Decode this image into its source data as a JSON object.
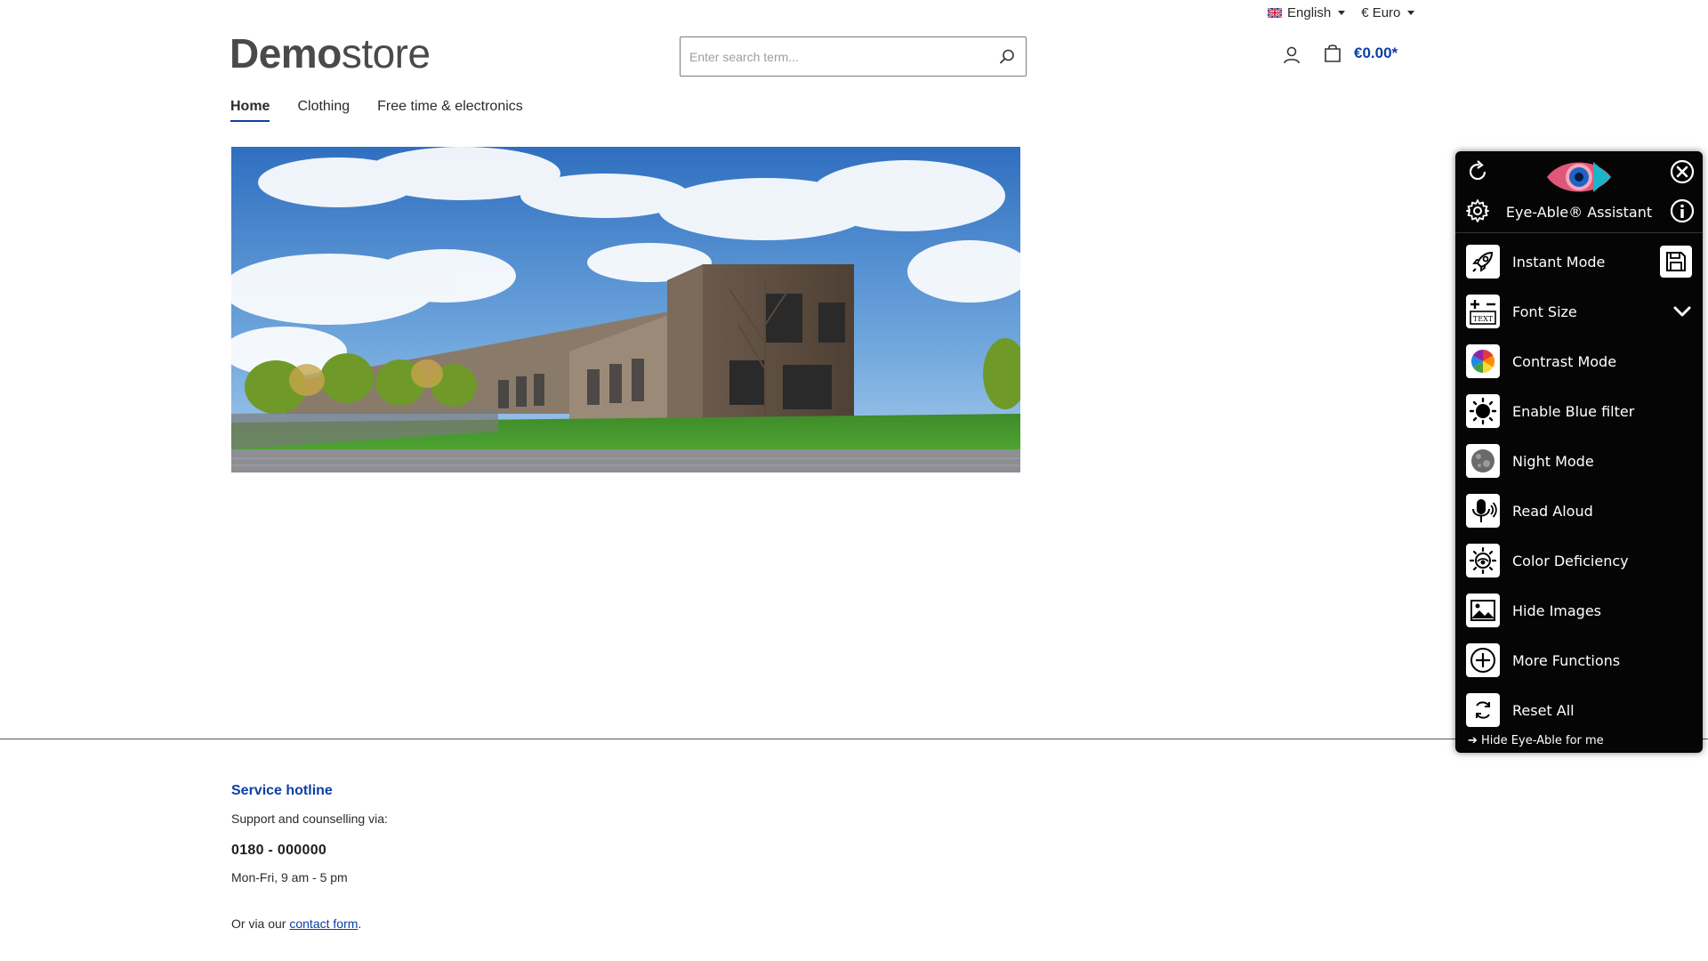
{
  "topbar": {
    "language": "English",
    "currency": "€ Euro"
  },
  "header": {
    "logo_bold": "Demo",
    "logo_light": "store",
    "search_placeholder": "Enter search term...",
    "cart_total": "€0.00*"
  },
  "nav": {
    "items": [
      {
        "label": "Home",
        "active": true
      },
      {
        "label": "Clothing",
        "active": false
      },
      {
        "label": "Free time & electronics",
        "active": false
      }
    ]
  },
  "footer": {
    "title": "Service hotline",
    "subtitle": "Support and counselling via:",
    "phone": "0180 - 000000",
    "hours": "Mon-Fri, 9 am - 5 pm",
    "contact_prefix": "Or via our ",
    "contact_link": "contact form",
    "contact_suffix": "."
  },
  "eyeable": {
    "title": "Eye-Able® Assistant",
    "items": [
      {
        "label": "Instant Mode",
        "icon": "rocket-icon"
      },
      {
        "label": "Font Size",
        "icon": "text-size-icon"
      },
      {
        "label": "Contrast Mode",
        "icon": "color-wheel-icon"
      },
      {
        "label": "Enable Blue filter",
        "icon": "sun-icon"
      },
      {
        "label": "Night Mode",
        "icon": "moon-icon"
      },
      {
        "label": "Read Aloud",
        "icon": "microphone-icon"
      },
      {
        "label": "Color Deficiency",
        "icon": "eye-sun-icon"
      },
      {
        "label": "Hide Images",
        "icon": "image-icon"
      },
      {
        "label": "More Functions",
        "icon": "plus-circle-icon"
      },
      {
        "label": "Reset All",
        "icon": "reset-icon"
      }
    ],
    "hide_text": "➔ Hide Eye-Able for me"
  },
  "colors": {
    "accent": "#0b3fa6",
    "panel_bg": "#050505"
  }
}
